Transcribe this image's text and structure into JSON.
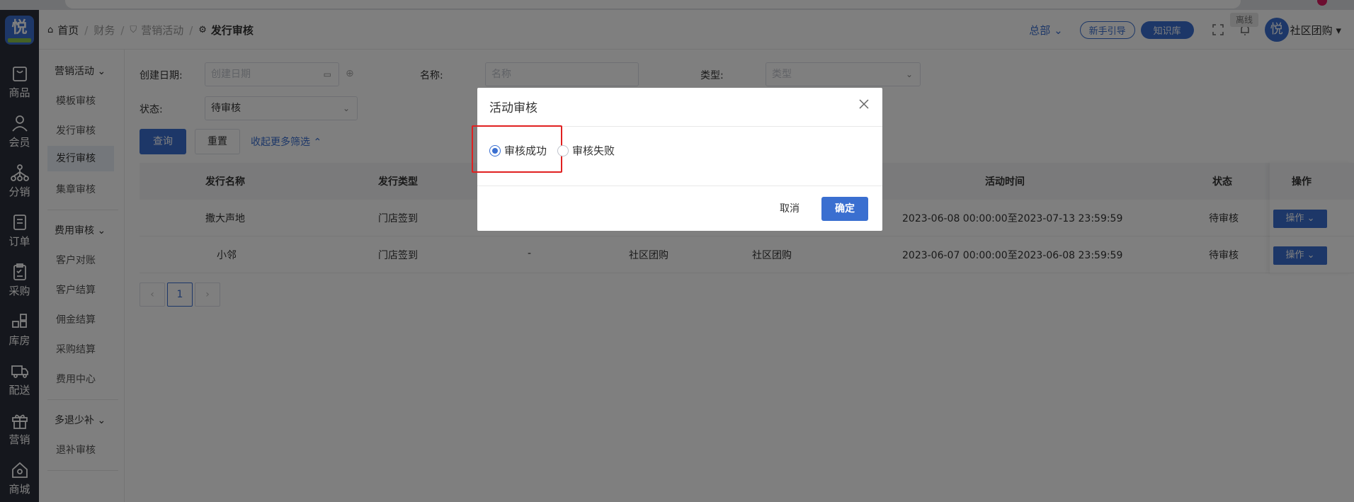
{
  "header": {
    "breadcrumb": [
      "首页",
      "财务",
      "营销活动",
      "发行审核"
    ],
    "org": "总部",
    "guide_label": "新手引导",
    "kb_label": "知识库",
    "offline_label": "离线",
    "user_name": "社区团购",
    "logo_char": "悦"
  },
  "icon_nav": [
    {
      "label": "商品",
      "icon": "bag-icon"
    },
    {
      "label": "会员",
      "icon": "user-icon"
    },
    {
      "label": "分销",
      "icon": "share-icon"
    },
    {
      "label": "订单",
      "icon": "order-icon"
    },
    {
      "label": "采购",
      "icon": "clipboard-icon"
    },
    {
      "label": "库房",
      "icon": "warehouse-icon"
    },
    {
      "label": "配送",
      "icon": "truck-icon"
    },
    {
      "label": "营销",
      "icon": "gift-icon"
    },
    {
      "label": "商城",
      "icon": "home-icon"
    }
  ],
  "sub_nav": {
    "group1": {
      "title": "营销活动",
      "items": [
        "模板审核",
        "发行审核",
        "发行审核",
        "集章审核"
      ]
    },
    "group2": {
      "title": "费用审核",
      "items": [
        "客户对账",
        "客户结算",
        "佣金结算",
        "采购结算",
        "费用中心"
      ]
    },
    "group3": {
      "title": "多退少补",
      "items": [
        "退补审核"
      ]
    }
  },
  "filters": {
    "date_label": "创建日期:",
    "date_placeholder": "创建日期",
    "name_label": "名称:",
    "name_placeholder": "名称",
    "type_label": "类型:",
    "type_placeholder": "类型",
    "status_label": "状态:",
    "status_value": "待审核",
    "query_label": "查询",
    "reset_label": "重置",
    "collapse_label": "收起更多筛选"
  },
  "table": {
    "headers": [
      "发行名称",
      "发行类型",
      "活动时间",
      "状态",
      "操作"
    ],
    "rows": [
      {
        "name": "撒大声地",
        "type": "门店签到",
        "c3": "",
        "c4": "",
        "c5": "",
        "time": "2023-06-08 00:00:00至2023-07-13 23:59:59",
        "status": "待审核",
        "op": "操作"
      },
      {
        "name": "小邻",
        "type": "门店签到",
        "c3": "-",
        "c4": "社区团购",
        "c5": "社区团购",
        "time": "2023-06-07 00:00:00至2023-06-08 23:59:59",
        "status": "待审核",
        "op": "操作"
      }
    ]
  },
  "pagination": {
    "prev": "‹",
    "current": "1",
    "next": "›"
  },
  "modal": {
    "title": "活动审核",
    "option_success": "审核成功",
    "option_fail": "审核失败",
    "selected": "审核成功",
    "cancel_label": "取消",
    "ok_label": "确定"
  },
  "colors": {
    "primary": "#3a6fd0",
    "sidebar": "#2b2f3a",
    "highlight": "#e02020"
  }
}
